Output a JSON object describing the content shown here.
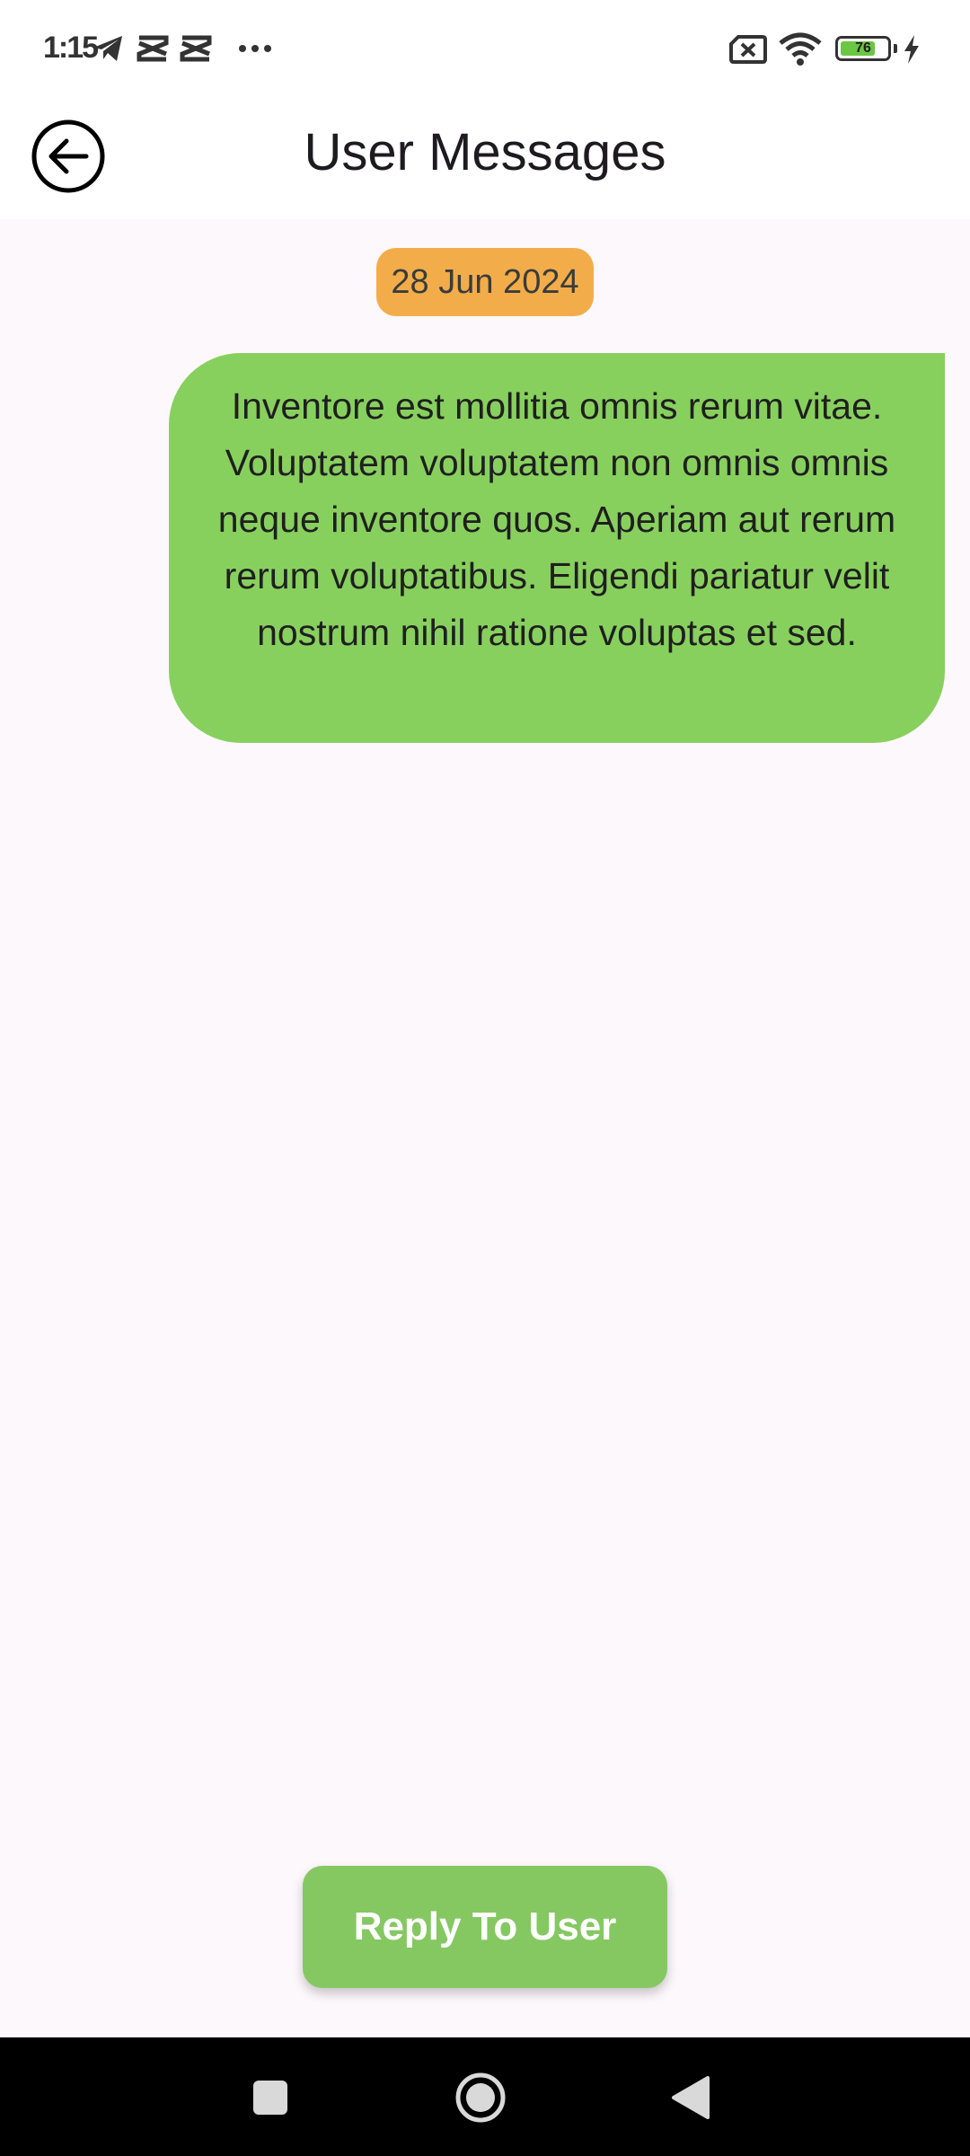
{
  "status_bar": {
    "time": "1:15",
    "battery_level": "76",
    "battery_fraction": 0.76,
    "icons": [
      "telegram-icon",
      "capcut-icon",
      "capcut-icon",
      "more-dots-icon",
      "no-sim-icon",
      "wifi-icon",
      "battery-icon",
      "charging-icon"
    ]
  },
  "app_bar": {
    "title": "User Messages",
    "back_icon": "arrow-left-circle-icon"
  },
  "messages": {
    "date": "28 Jun 2024",
    "items": [
      {
        "text": "Inventore est mollitia omnis rerum vitae. Voluptatem voluptatem non omnis omnis neque inventore quos. Aperiam aut rerum rerum voluptatibus. Eligendi pariatur velit nostrum nihil ratione voluptas et sed."
      }
    ]
  },
  "actions": {
    "reply_label": "Reply To User"
  },
  "navigation": {
    "icons": [
      "recents-square-icon",
      "home-circle-icon",
      "back-triangle-icon"
    ]
  },
  "colors": {
    "date_chip": "#f2ad4a",
    "bubble": "#88d05e",
    "reply_button": "#85c862",
    "background": "#fdf8fc"
  }
}
